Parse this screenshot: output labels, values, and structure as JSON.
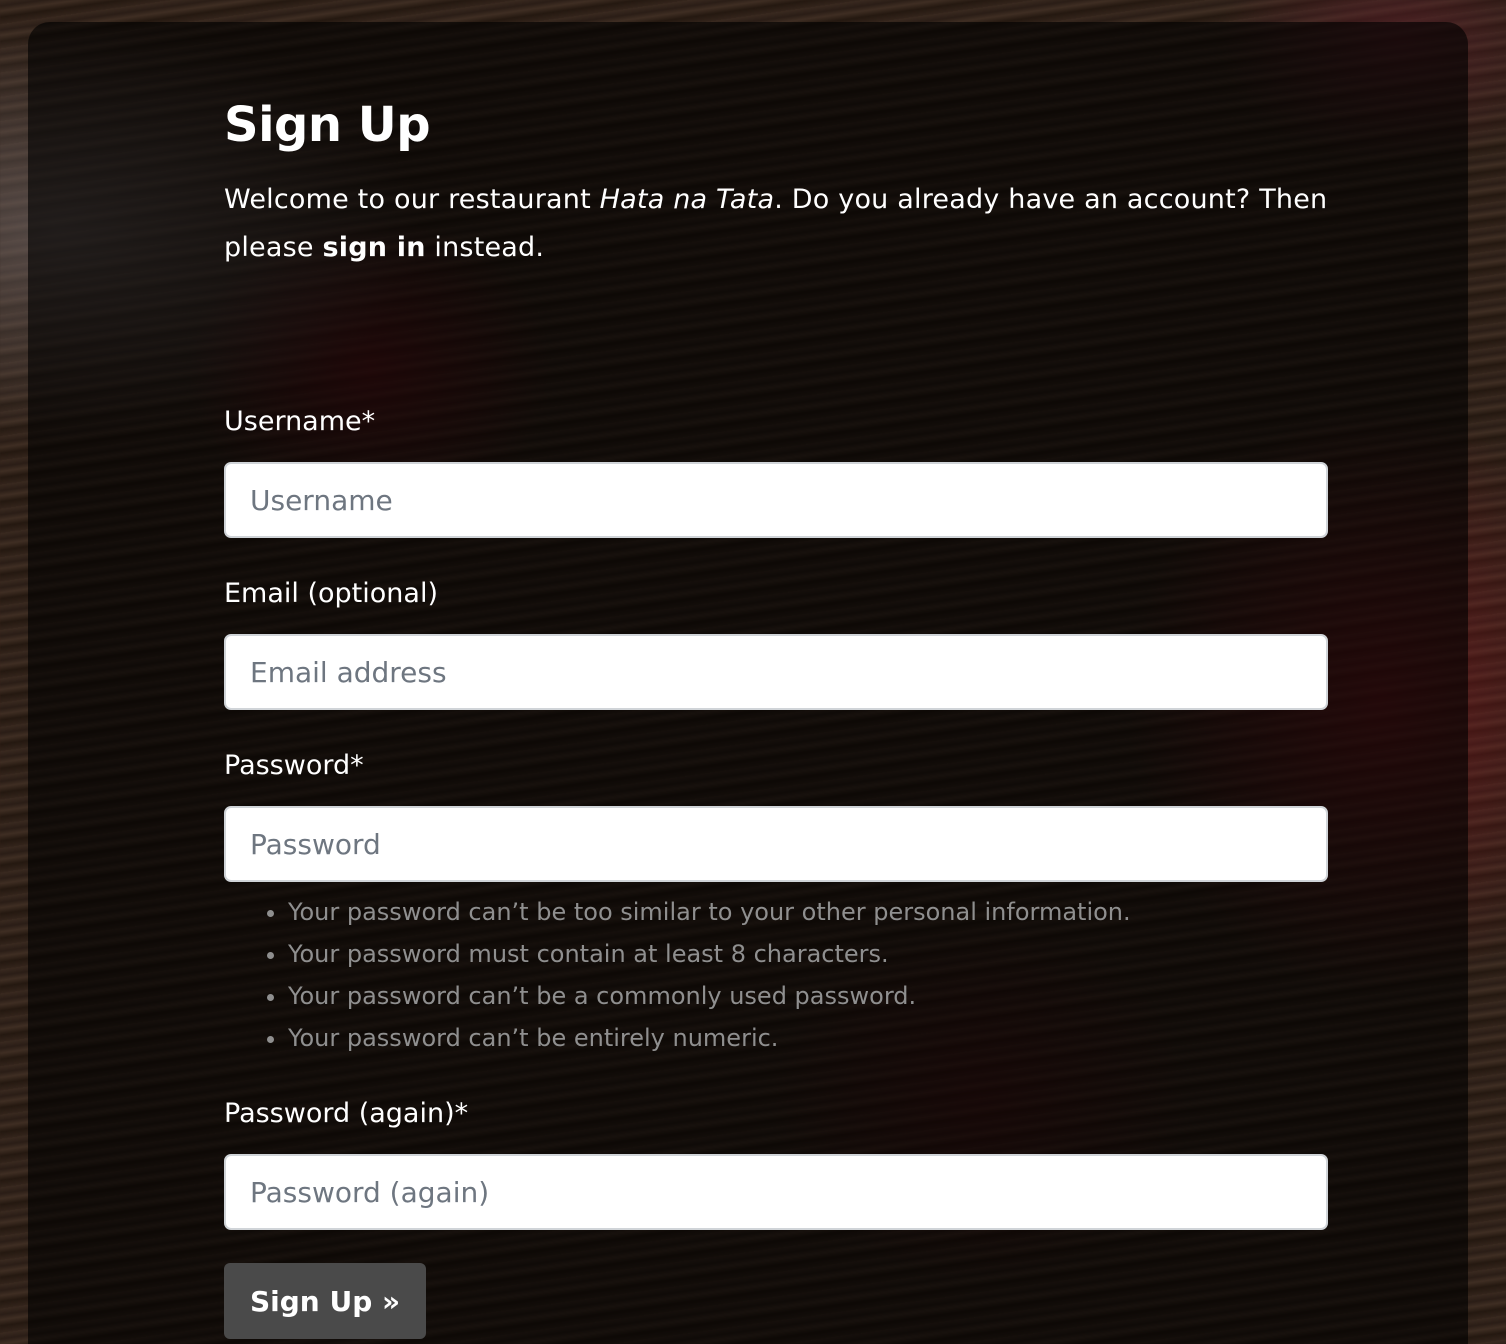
{
  "page": {
    "title": "Sign Up",
    "intro": {
      "part1": "Welcome to our restaurant ",
      "restaurant_name": "Hata na Tata",
      "part2": ". Do you already have an account? Then please ",
      "signin_link": "sign in",
      "part3": " instead."
    }
  },
  "form": {
    "username": {
      "label": "Username*",
      "placeholder": "Username",
      "value": ""
    },
    "email": {
      "label": "Email (optional)",
      "placeholder": "Email address",
      "value": ""
    },
    "password": {
      "label": "Password*",
      "placeholder": "Password",
      "value": "",
      "help": [
        "Your password can’t be too similar to your other personal information.",
        "Your password must contain at least 8 characters.",
        "Your password can’t be a commonly used password.",
        "Your password can’t be entirely numeric."
      ]
    },
    "password2": {
      "label": "Password (again)*",
      "placeholder": "Password (again)",
      "value": ""
    },
    "submit_label": "Sign Up »"
  },
  "colors": {
    "panel_overlay": "#000000",
    "input_background": "#ffffff",
    "placeholder": "#6e7680",
    "help_text": "#8f8f8f",
    "button_background": "#4a4a4a",
    "text": "#ffffff"
  }
}
